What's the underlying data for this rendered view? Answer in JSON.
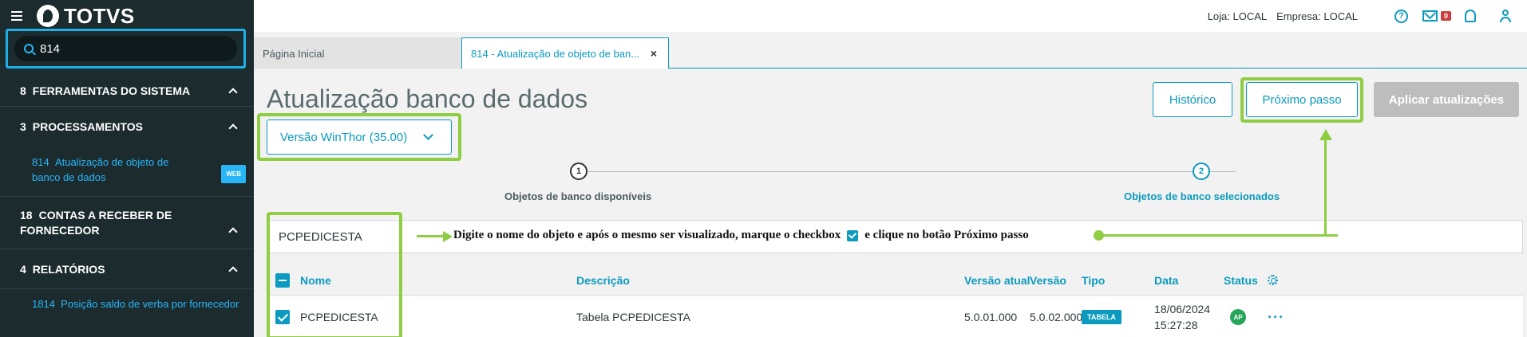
{
  "sidebar": {
    "logo_text": "TOTVS",
    "search_value": "814",
    "groups": [
      {
        "num": "8",
        "label": "FERRAMENTAS DO SISTEMA"
      },
      {
        "num": "3",
        "label": "PROCESSAMENTOS"
      },
      {
        "num": "18",
        "label": "CONTAS A RECEBER DE FORNECEDOR"
      },
      {
        "num": "4",
        "label": "RELATÓRIOS"
      }
    ],
    "sub_items": [
      {
        "num": "814",
        "label": "Atualização de objeto de banco de dados",
        "badge": "WEB"
      },
      {
        "num": "1814",
        "label": "Posição saldo de verba por fornecedor"
      }
    ]
  },
  "header": {
    "loja": "Loja: LOCAL",
    "empresa": "Empresa: LOCAL",
    "mail_count": "0",
    "help_glyph": "?"
  },
  "tabs": [
    {
      "label": "Página Inicial"
    },
    {
      "label": "814 - Atualização de objeto de ban..."
    }
  ],
  "main": {
    "title": "Atualização banco de dados",
    "buttons": {
      "historico": "Histórico",
      "proximo": "Próximo passo",
      "aplicar": "Aplicar atualizações"
    },
    "version_select": "Versão WinThor (35.00)",
    "steps": [
      {
        "num": "1",
        "label": "Objetos de banco disponíveis"
      },
      {
        "num": "2",
        "label": "Objetos de banco selecionados"
      }
    ],
    "filter_value": "PCPEDICESTA",
    "instruction_before": "Digite o nome do objeto e após o mesmo ser visualizado, marque o checkbox",
    "instruction_after": "e clique no botão Próximo passo"
  },
  "table": {
    "columns": [
      "Nome",
      "Descrição",
      "Versão atual",
      "Versão",
      "Tipo",
      "Data",
      "Status"
    ],
    "rows": [
      {
        "nome": "PCPEDICESTA",
        "descricao": "Tabela PCPEDICESTA",
        "versao_atual": "5.0.01.000",
        "versao": "5.0.02.000",
        "tipo": "TABELA",
        "data_date": "18/06/2024",
        "data_time": "15:27:28",
        "status": "AP"
      }
    ]
  },
  "colors": {
    "accent": "#0c9abe",
    "highlight": "#8fcd43",
    "sidebar": "#1c2b2e"
  }
}
